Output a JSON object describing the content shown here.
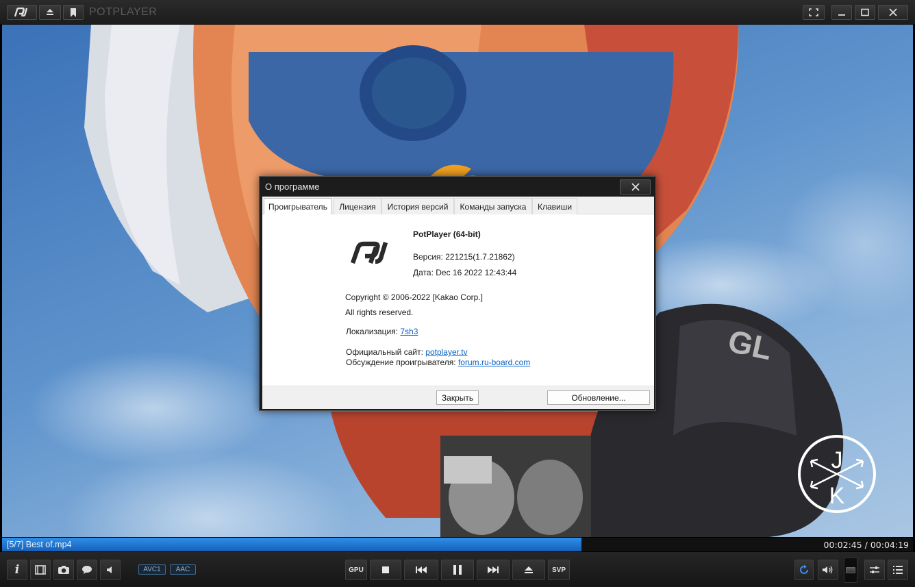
{
  "app": {
    "title": "POTPLAYER"
  },
  "dialog": {
    "title": "О программе",
    "tabs": [
      {
        "label": "Проигрыватель",
        "active": true
      },
      {
        "label": "Лицензия",
        "active": false
      },
      {
        "label": "История версий",
        "active": false
      },
      {
        "label": "Команды запуска",
        "active": false
      },
      {
        "label": "Клавиши",
        "active": false
      }
    ],
    "product_name": "PotPlayer (64-bit)",
    "version_text": "Версия: 221215(1.7.21862)",
    "date_text": "Дата: Dec 16 2022 12:43:44",
    "copyright": "Copyright © 2006-2022 [Kakao Corp.]",
    "rights": "All rights reserved.",
    "localization_label": "Локализация:",
    "localization_link": "7sh3",
    "site_label": "Официальный сайт:",
    "site_link": "potplayer.tv",
    "forum_label": "Обсуждение проигрывателя:",
    "forum_link": "forum.ru-board.com",
    "close_button": "Закрыть",
    "update_button": "Обновление..."
  },
  "watermark": {
    "letters": [
      "J",
      "K"
    ]
  },
  "status": {
    "file": "[5/7] Best of.mp4",
    "time": "00:02:45 / 00:04:19",
    "progress_fraction": 0.636
  },
  "controls": {
    "video_codec": "AVC1",
    "audio_codec": "AAC",
    "gpu_label": "GPU",
    "svp_label": "SVP"
  },
  "colors": {
    "accent": "#1f7ad8",
    "link": "#0a63c4"
  }
}
